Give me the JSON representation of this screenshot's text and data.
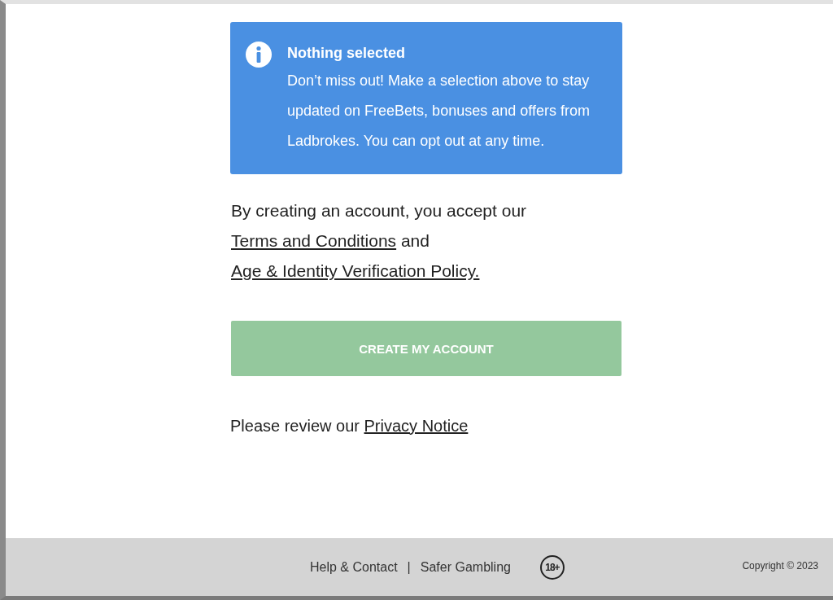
{
  "notice": {
    "title": "Nothing selected",
    "text": "Don’t miss out! Make a selection above to stay updated on FreeBets, bonuses and offers from Ladbrokes. You can opt out at any time."
  },
  "terms": [
    {
      "kind": "text",
      "text": "By creating an account, you accept our "
    },
    {
      "kind": "link",
      "text": "Terms and Conditions"
    },
    {
      "kind": "text",
      "text": " and "
    },
    {
      "kind": "link",
      "text": "Age & Identity Verification Policy."
    }
  ],
  "create_button": {
    "label": "CREATE MY ACCOUNT",
    "disabled": true
  },
  "privacy": [
    {
      "kind": "text",
      "text": "Please review our "
    },
    {
      "kind": "link",
      "text": "Privacy Notice"
    }
  ],
  "footer": {
    "links": [
      "Help & Contact",
      "Safer Gambling"
    ],
    "separator": "|",
    "age_badge": "18+",
    "copyright": "Copyright © 2023"
  }
}
